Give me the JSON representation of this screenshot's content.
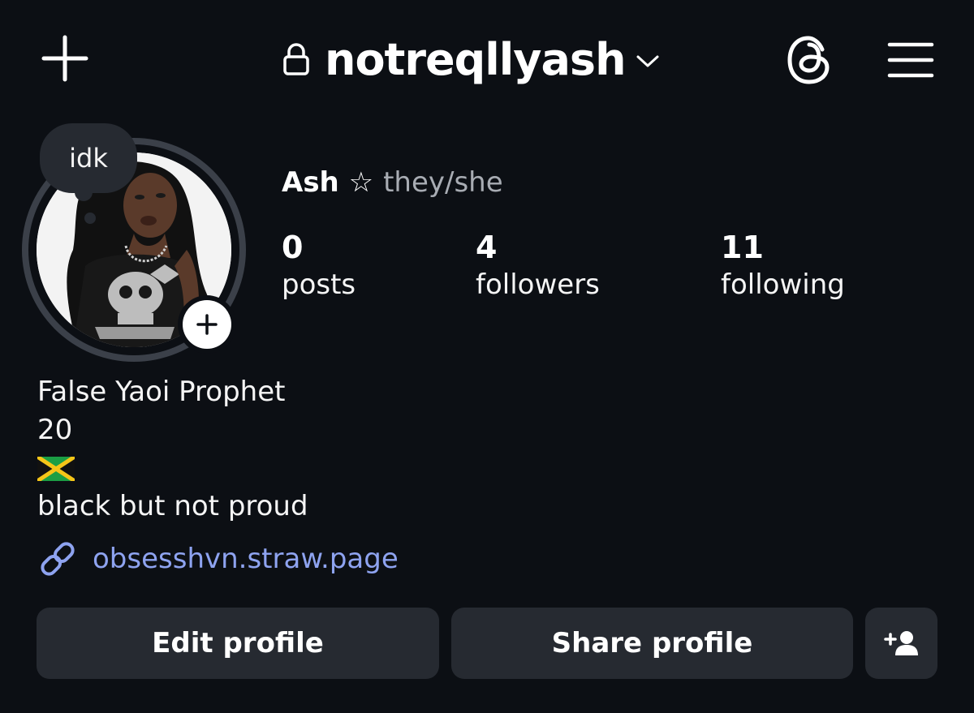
{
  "header": {
    "username": "notreqllyash",
    "icons": {
      "create": "plus-icon",
      "lock": "lock-icon",
      "switch_account": "chevron-down-icon",
      "threads": "threads-icon",
      "menu": "hamburger-menu-icon"
    }
  },
  "note": {
    "text": "idk"
  },
  "profile": {
    "display_name": "Ash ☆",
    "pronouns": "they/she"
  },
  "stats": {
    "posts": {
      "value": "0",
      "label": "posts"
    },
    "followers": {
      "value": "4",
      "label": "followers"
    },
    "following": {
      "value": "11",
      "label": "following"
    }
  },
  "bio": {
    "line1": "False Yaoi Prophet",
    "line2": "20",
    "flag_icon": "jamaica-flag-icon",
    "line4": "black but not proud"
  },
  "link": {
    "icon": "link-icon",
    "text": "obsesshvn.straw.page"
  },
  "actions": {
    "edit_label": "Edit profile",
    "share_label": "Share profile",
    "add_user_icon": "add-user-icon"
  },
  "colors": {
    "background": "#0c0f14",
    "button": "#262a31",
    "link": "#8ea3f0",
    "muted_text": "#a8acb3"
  }
}
